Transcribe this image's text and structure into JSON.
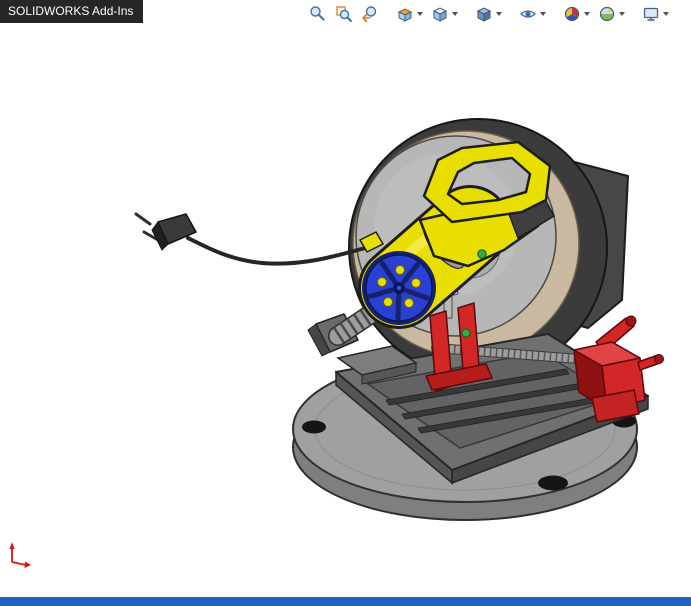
{
  "tab": {
    "label": "SOLIDWORKS Add-Ins"
  },
  "toolbar": {
    "items": [
      {
        "icon": "zoom-to-fit-icon",
        "dropdown": false
      },
      {
        "icon": "zoom-to-area-icon",
        "dropdown": false
      },
      {
        "icon": "previous-view-icon",
        "dropdown": false
      },
      {
        "icon": "section-view-icon",
        "dropdown": true
      },
      {
        "icon": "view-orientation-icon",
        "dropdown": true
      },
      {
        "icon": "display-style-icon",
        "dropdown": true
      },
      {
        "icon": "hide-show-items-icon",
        "dropdown": true
      },
      {
        "icon": "edit-appearance-icon",
        "dropdown": true
      },
      {
        "icon": "apply-scene-icon",
        "dropdown": true
      },
      {
        "icon": "view-settings-icon",
        "dropdown": true
      }
    ]
  },
  "viewport": {
    "model": "abrasive-chop-saw-assembly",
    "parts": [
      "blade-guard",
      "cutting-wheel",
      "power-cord",
      "power-plug",
      "base-plate",
      "saw-bed",
      "lead-screw",
      "vise-bracket-front",
      "vise-bracket-right",
      "pivot-hinge",
      "return-spring",
      "motor-housing",
      "carry-handle",
      "motor-fan-cover"
    ],
    "origin_marker": "origin-triad-icon"
  },
  "status_bar": {
    "visible": true
  },
  "palette": {
    "bg": "#ffffff",
    "tab-bg": "#262626",
    "tab-fg": "#ffffff",
    "statusbar": "#1e63c0",
    "saw-yellow": "#e8de00",
    "saw-red": "#d32626",
    "saw-red-dark": "#8f1111",
    "saw-blue": "#2a3fd4",
    "saw-blue-dark": "#16226b",
    "saw-green": "#2fae44",
    "blade-face": "#b7b7b7",
    "blade-tan": "#c9b9a0",
    "guard-dark": "#3b3b3b",
    "base-top": "#a0a0a0",
    "base-side": "#7f7f7f",
    "bed-top": "#707070",
    "bed-recess": "#636363",
    "slot-dark": "#383838",
    "outline": "#1e1e1e",
    "cord": "#262626",
    "metal": "#9c9c9c",
    "annotation-red": "#e01010"
  }
}
